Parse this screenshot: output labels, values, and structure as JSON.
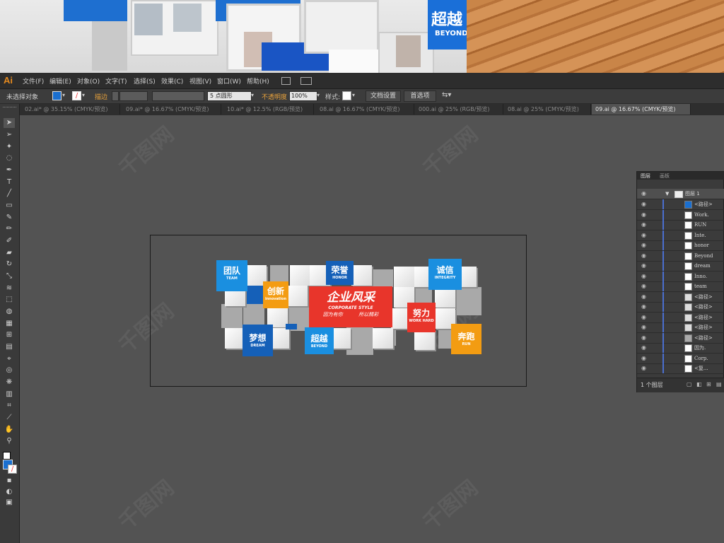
{
  "app": {
    "logo": "Ai"
  },
  "menu": [
    "文件(F)",
    "编辑(E)",
    "对象(O)",
    "文字(T)",
    "选择(S)",
    "效果(C)",
    "视图(V)",
    "窗口(W)",
    "帮助(H)"
  ],
  "control": {
    "selection": "未选择对象",
    "stroke_label": "描边",
    "brush": "5 点圆形",
    "opacity_label": "不透明度",
    "opacity_value": "100%",
    "style_label": "样式:",
    "doc_setup": "文档设置",
    "prefs": "首选项"
  },
  "tabs": [
    "02.ai* @ 35.15% (CMYK/预览)",
    "09.ai* @ 16.67% (CMYK/预览)",
    "10.ai* @ 12.5% (RGB/预览)",
    "08.ai @ 16.67% (CMYK/预览)",
    "000.ai @ 25% (RGB/预览)",
    "08.ai @ 25% (CMYK/预览)",
    "09.ai @ 16.67% (CMYK/预览)"
  ],
  "active_tab": 6,
  "preview": {
    "sign_text": "超越",
    "sign_sub": "BEYOND"
  },
  "design": {
    "title": "企业风采",
    "title_en": "CORPORATE STYLE",
    "slogan_left": "因为有你",
    "slogan_right": "所以精彩",
    "labels": [
      {
        "cn": "团队",
        "en": "TEAM"
      },
      {
        "cn": "创新",
        "en": "innovation"
      },
      {
        "cn": "荣誉",
        "en": "HONOR"
      },
      {
        "cn": "诚信",
        "en": "INTEGRITY"
      },
      {
        "cn": "努力",
        "en": "WORK HARD"
      },
      {
        "cn": "梦想",
        "en": "DREAM"
      },
      {
        "cn": "超越",
        "en": "BEYOND"
      },
      {
        "cn": "奔跑",
        "en": "RUN"
      }
    ],
    "colors": {
      "blue": "#1a8fe0",
      "dark_blue": "#1560b8",
      "orange": "#f39c12",
      "red": "#e8352b"
    }
  },
  "layers_panel": {
    "tabs": [
      "图层",
      "画板"
    ],
    "layer_name": "图层 1",
    "items": [
      "<路径>",
      "Work.",
      "RUN",
      "Inte.",
      "honor",
      "Beyond",
      "dream",
      "Inno.",
      "team",
      "<路径>",
      "<路径>",
      "<路径>",
      "<路径>",
      "<路径>",
      "因为.",
      "Corp.",
      "<复..."
    ],
    "footer": "1 个图层"
  },
  "watermark": "千图网"
}
